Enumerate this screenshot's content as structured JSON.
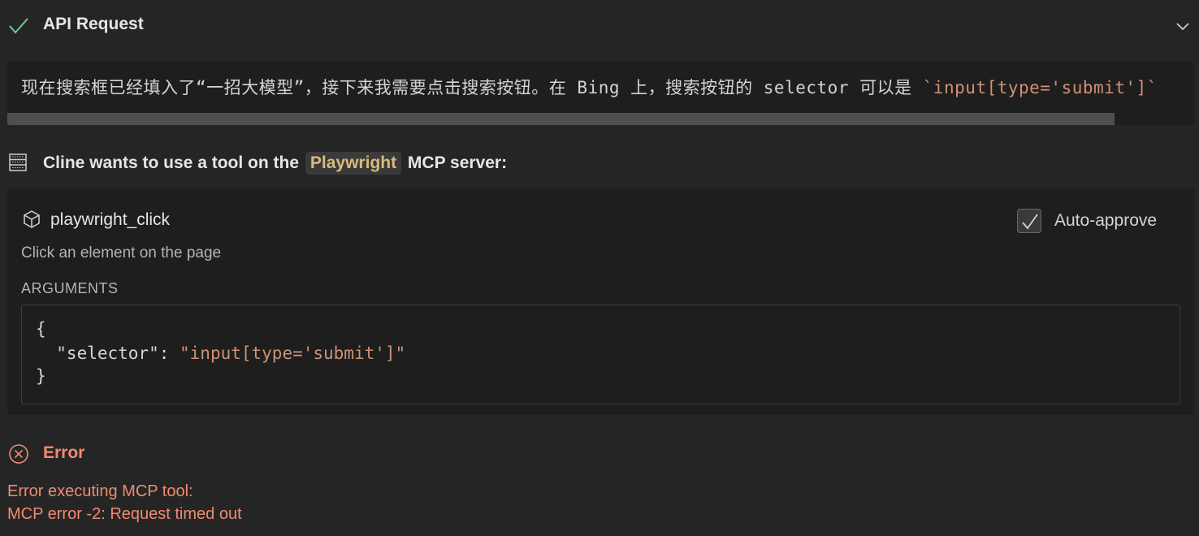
{
  "api_request": {
    "title": "API Request",
    "status_icon": "check-icon",
    "toggle_icon": "chevron-down-icon"
  },
  "thinking": {
    "text": "现在搜索框已经填入了“一招大模型”，接下来我需要点击搜索按钮。在 Bing 上，搜索按钮的 selector 可以是 ",
    "code": "`input[type='submit']`"
  },
  "tool_request": {
    "prefix": "Cline wants to use a tool on the",
    "server_name": "Playwright",
    "suffix": "MCP server:",
    "icon": "server-icon"
  },
  "tool": {
    "name": "playwright_click",
    "icon": "cube-icon",
    "description": "Click an element on the page",
    "auto_approve_label": "Auto-approve",
    "auto_approve_checked": true,
    "arguments_label": "ARGUMENTS",
    "arguments": {
      "open": "{",
      "key": "  \"selector\": ",
      "value": "\"input[type='submit']\"",
      "close": "}"
    }
  },
  "error": {
    "title": "Error",
    "icon": "error-circle-icon",
    "line1": "Error executing MCP tool:",
    "line2": "MCP error -2: Request timed out"
  },
  "colors": {
    "background": "#252526",
    "panel": "#1e1e1e",
    "accent_success": "#73c991",
    "error": "#f08c6f",
    "string": "#ce9178",
    "server_pill_text": "#d7ba7d"
  }
}
